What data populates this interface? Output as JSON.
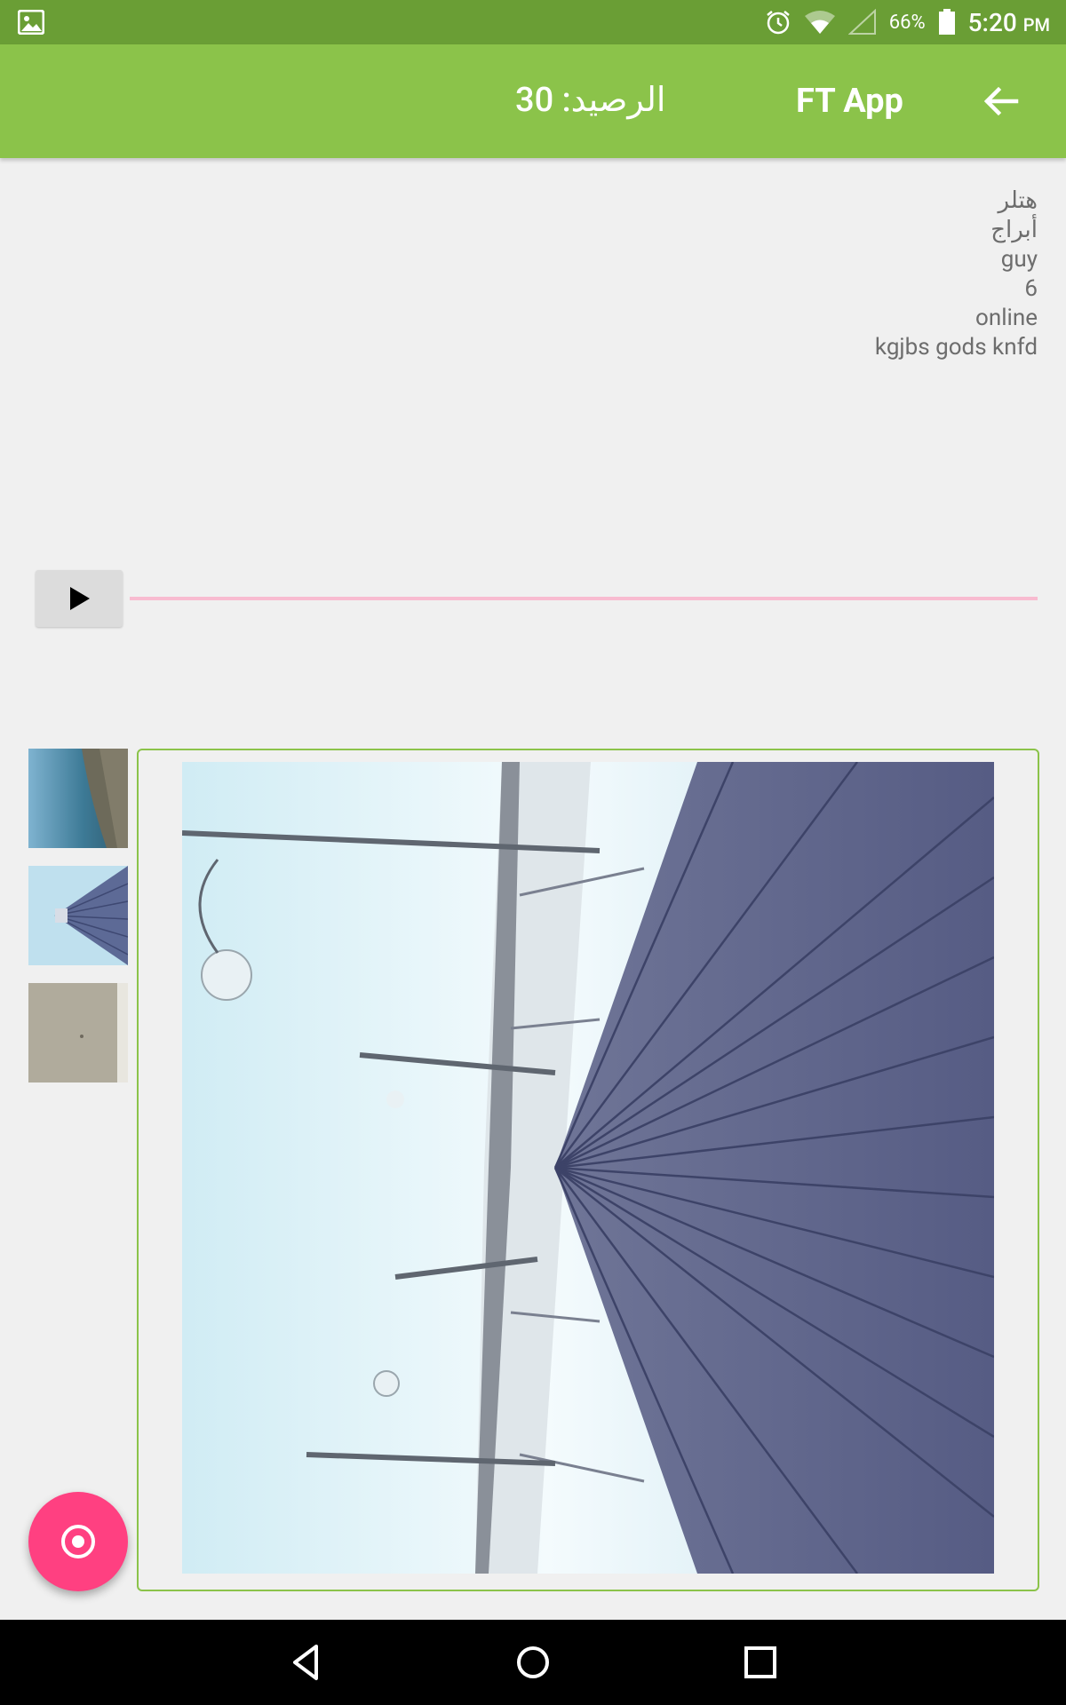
{
  "status_bar": {
    "battery": "66%",
    "time": "5:20",
    "ampm": "PM",
    "icons": [
      "gallery-icon",
      "alarm-icon",
      "wifi-icon",
      "cell-signal-icon",
      "battery-icon"
    ]
  },
  "app_bar": {
    "title": "FT App",
    "balance": "الرصيد: 30",
    "back_icon": "arrow-back-icon"
  },
  "info": {
    "lines": [
      "هتلر",
      "أبراج",
      "guy",
      "6",
      "online",
      "kgjbs gods knfd"
    ]
  },
  "player": {
    "play_icon": "play-icon",
    "progress": 0
  },
  "thumbnails": [
    {
      "name": "beach-thumbnail"
    },
    {
      "name": "pier-thumbnail"
    },
    {
      "name": "room-thumbnail"
    }
  ],
  "fab": {
    "icon": "record-icon"
  },
  "colors": {
    "status_bar": "#6a9e35",
    "app_bar": "#8bc34a",
    "accent": "#ff4081",
    "progress_track": "#f8bbd0"
  }
}
